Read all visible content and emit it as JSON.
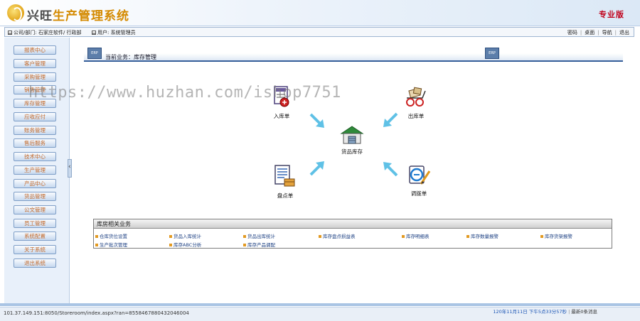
{
  "header": {
    "title_prefix": "兴旺",
    "title_main": "生产管理系统",
    "edition": "专业版"
  },
  "infobar": {
    "company_label": "公司/部门: 石家庄",
    "company_extra": "软件/ 行政部",
    "user_label": "用户: 系统管理员",
    "links": [
      "密码",
      "桌面",
      "导航",
      "退出"
    ]
  },
  "sidebar": {
    "items": [
      "报表中心",
      "客户管理",
      "采购管理",
      "销售管理",
      "库存管理",
      "应收应付",
      "账务管理",
      "售后服务",
      "技术中心",
      "生产管理",
      "产品中心",
      "货品管理",
      "公文管理",
      "员工管理",
      "系统配置",
      "关于系统",
      "退出系统"
    ]
  },
  "main": {
    "current_business": "当前业务：库存管理",
    "erp_badge": "ERP",
    "flow": {
      "in": "入库单",
      "out": "出库单",
      "center": "货品库存",
      "count": "盘点单",
      "transfer": "调拨单"
    },
    "watermark": "https://www.huzhan.com/ishop7751"
  },
  "related": {
    "title": "库房相关业务",
    "row1": [
      "仓库货位设置",
      "货品入库统计",
      "货品出库统计",
      "库存盘点损益表",
      "库存明细表",
      "库存数量报警",
      "库存货架报警"
    ],
    "row2": [
      "生产批次管理",
      "库存ABC分析",
      "库存产品调配"
    ]
  },
  "status": {
    "url": "101.37.149.151:8050/Storeroom/index.aspx?ran=8558467880432046004",
    "datetime": "120年11月11日 下午5点33分57秒",
    "messages": "最新0条消息"
  },
  "colors": {
    "accent_blue": "#355d99",
    "nav_text": "#c46a2a",
    "arrow": "#5fc1e6"
  }
}
